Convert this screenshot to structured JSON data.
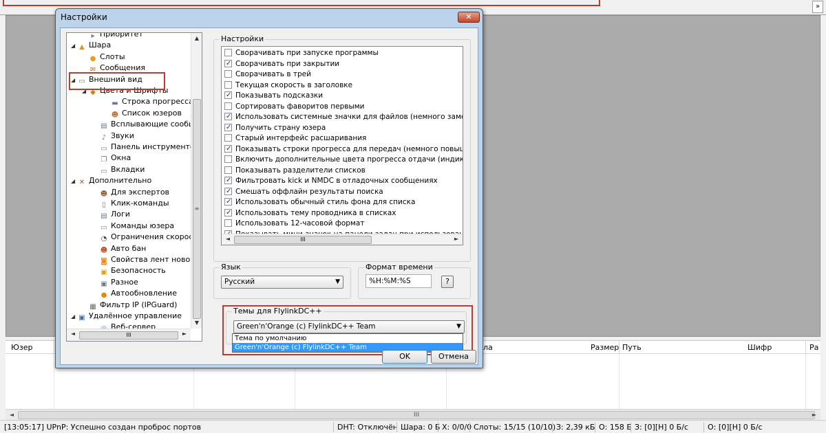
{
  "dialog": {
    "title": "Настройки",
    "close_label": "✕",
    "ok_label": "OK",
    "cancel_label": "Отмена"
  },
  "tree": {
    "items": [
      {
        "label": "Приоритет",
        "icon": "priority-icon",
        "expander": ""
      },
      {
        "label": "Шара",
        "icon": "share-icon",
        "expander": "◢"
      },
      {
        "label": "Слоты",
        "icon": "slots-icon",
        "expander": ""
      },
      {
        "label": "Сообщения",
        "icon": "messages-icon",
        "expander": ""
      },
      {
        "label": "Внешний вид",
        "icon": "window-icon",
        "expander": "◢"
      },
      {
        "label": "Цвета и Шрифты",
        "icon": "palette-icon",
        "expander": "◢"
      },
      {
        "label": "Строка прогресса",
        "icon": "progressbar-icon",
        "expander": ""
      },
      {
        "label": "Список юзеров",
        "icon": "users-icon",
        "expander": ""
      },
      {
        "label": "Всплывающие сообщен",
        "icon": "popup-icon",
        "expander": ""
      },
      {
        "label": "Звуки",
        "icon": "speaker-icon",
        "expander": ""
      },
      {
        "label": "Панель инструментов",
        "icon": "toolbar-icon",
        "expander": ""
      },
      {
        "label": "Окна",
        "icon": "windows-icon",
        "expander": ""
      },
      {
        "label": "Вкладки",
        "icon": "tabs-icon",
        "expander": ""
      },
      {
        "label": "Дополнительно",
        "icon": "tools-icon",
        "expander": "◢"
      },
      {
        "label": "Для экспертов",
        "icon": "expert-icon",
        "expander": ""
      },
      {
        "label": "Клик-команды",
        "icon": "mouse-icon",
        "expander": ""
      },
      {
        "label": "Логи",
        "icon": "log-icon",
        "expander": ""
      },
      {
        "label": "Команды юзера",
        "icon": "command-icon",
        "expander": ""
      },
      {
        "label": "Ограничения скорости",
        "icon": "speedometer-icon",
        "expander": ""
      },
      {
        "label": "Авто бан",
        "icon": "ban-icon",
        "expander": ""
      },
      {
        "label": "Свойства лент новостей",
        "icon": "rss-icon",
        "expander": ""
      },
      {
        "label": "Безопасность",
        "icon": "lock-icon",
        "expander": ""
      },
      {
        "label": "Разное",
        "icon": "monitor-icon",
        "expander": ""
      },
      {
        "label": "Автообновление",
        "icon": "update-icon",
        "expander": ""
      },
      {
        "label": "Фильтр IP (IPGuard)",
        "icon": "wall-icon",
        "expander": ""
      },
      {
        "label": "Удалённое управление",
        "icon": "remote-icon",
        "expander": "◢"
      },
      {
        "label": "Веб-сервер",
        "icon": "web-icon",
        "expander": ""
      }
    ]
  },
  "settings": {
    "group_label": "Настройки",
    "options": [
      {
        "label": "Сворачивать при запуске программы",
        "checked": false
      },
      {
        "label": "Сворачивать при закрытии",
        "checked": true
      },
      {
        "label": "Сворачивать в трей",
        "checked": false
      },
      {
        "label": "Текущая скорость в заголовке",
        "checked": false
      },
      {
        "label": "Показывать подсказки",
        "checked": true
      },
      {
        "label": "Сортировать фаворитов первыми",
        "checked": false
      },
      {
        "label": "Использовать системные значки для файлов (немного замедляет п",
        "checked": true
      },
      {
        "label": "Получить страну юзера",
        "checked": true
      },
      {
        "label": "Старый интерфейс расшаривания",
        "checked": false
      },
      {
        "label": "Показывать строки прогресса для передач (немного повышает наг",
        "checked": true
      },
      {
        "label": "Включить дополнительные цвета прогресса отдачи (индикация ко",
        "checked": false
      },
      {
        "label": "Показывать разделители списков",
        "checked": false
      },
      {
        "label": "Фильтровать kick и NMDC в отладочных сообщениях",
        "checked": true
      },
      {
        "label": "Смешать оффлайн результаты поиска",
        "checked": true
      },
      {
        "label": "Использовать обычный стиль фона для списка",
        "checked": true
      },
      {
        "label": "Использовать тему проводника в списках",
        "checked": true
      },
      {
        "label": "Использовать 12-часовой формат",
        "checked": false
      },
      {
        "label": "Показывать мини-значок на панели задач при использовании друг",
        "checked": true
      }
    ]
  },
  "language": {
    "group_label": "Язык",
    "selected": "Русский"
  },
  "time_format": {
    "group_label": "Формат времени",
    "value": "%H:%M:%S",
    "help_label": "?"
  },
  "themes": {
    "group_label": "Темы для FlylinkDC++",
    "selected": "Green'n'Orange (c) FlylinkDC++ Team",
    "options": [
      "Тема по умолчанию",
      "Green'n'Orange (c) FlylinkDC++ Team"
    ]
  },
  "list": {
    "columns": {
      "user": "Юзер",
      "name": "ла",
      "size": "Размер",
      "path": "Путь",
      "cipher": "Шифр",
      "extra": "Ра"
    }
  },
  "status": {
    "log": "[13:05:17] UPnP: Успешно создан проброс портов",
    "dht": "DHT: Отключён",
    "share": "Шара: 0 Б",
    "hubs": "Х: 0/0/0",
    "slots": "Слоты: 15/15 (10/10)",
    "downloaded": "З: 2,39 кБ",
    "uploaded": "О: 158 Б",
    "download_speed": "З: [0][H] 0 Б/с",
    "upload_speed": "О: [0][H] 0 Б/с"
  },
  "scroll_glyphs": {
    "up": "▲",
    "down": "▼",
    "left": "◄",
    "right": "►",
    "grip_h": "III",
    "grip_v": "≡"
  },
  "top_scroll_glyph": "»",
  "colors": {
    "highlight_red": "#c0392b",
    "selection_blue": "#3399ff",
    "dialog_frame": "#bcd3ec"
  }
}
